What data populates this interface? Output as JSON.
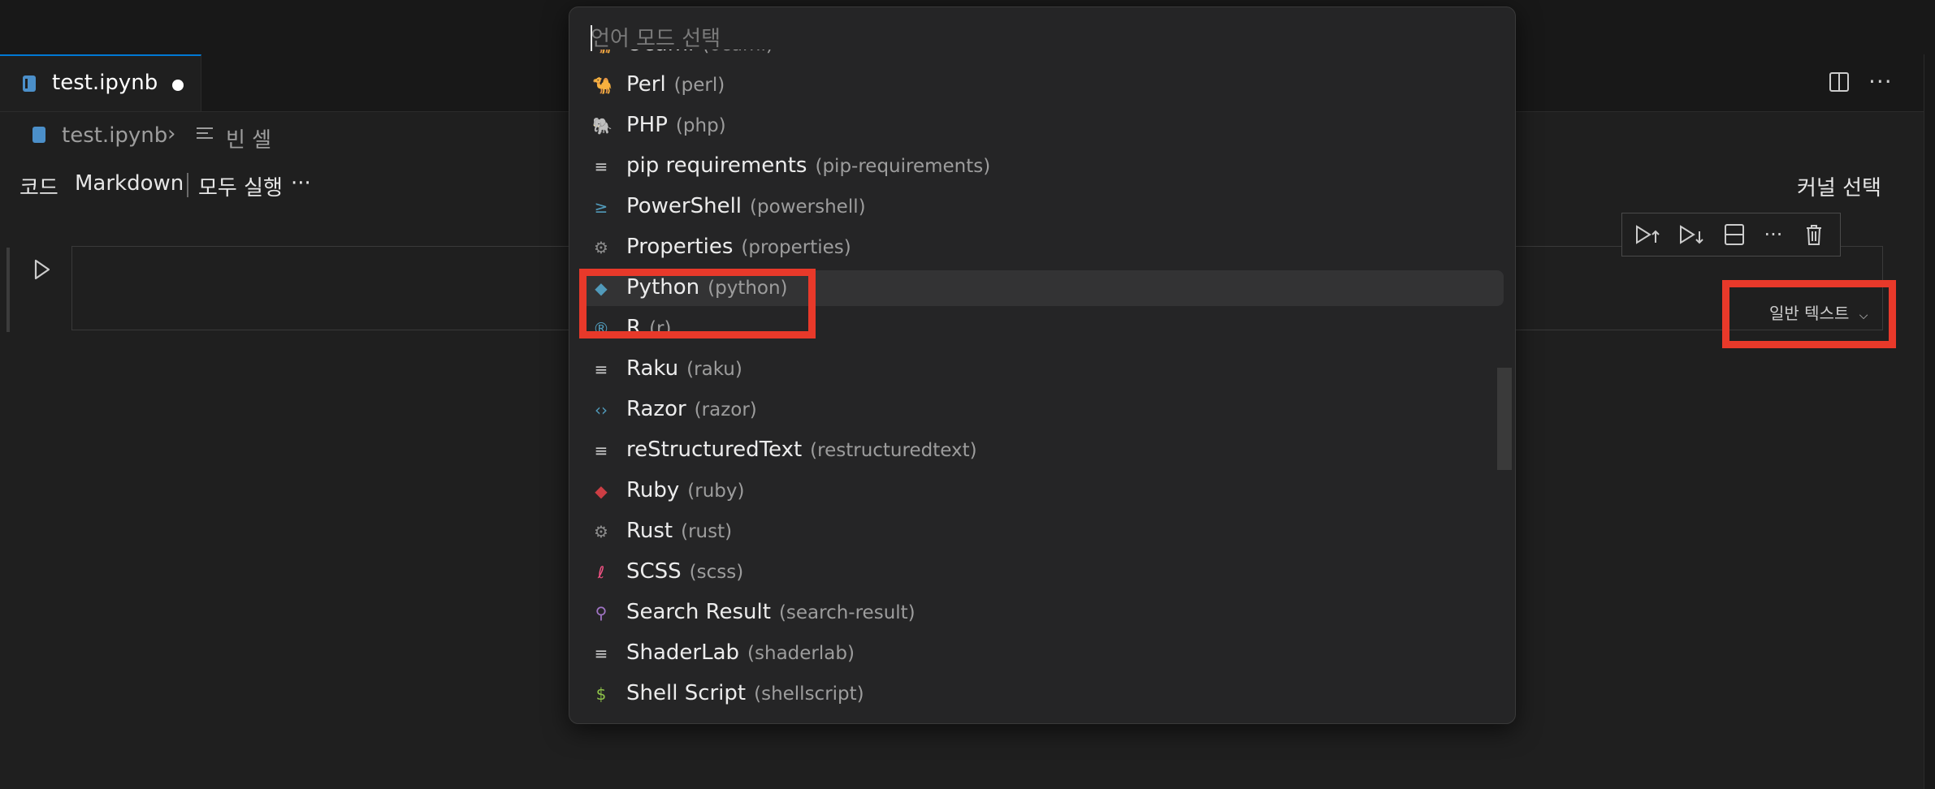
{
  "tab": {
    "label": "test.ipynb",
    "dirty": true
  },
  "breadcrumb": {
    "file": "test.ipynb",
    "separator": "›",
    "cell": "빈 셀"
  },
  "toolbar": {
    "code": "코드",
    "markdown": "Markdown",
    "run_all": "모두 실행",
    "more": "···",
    "kernel": "커널 선택"
  },
  "cell": {
    "language_button": "일반 텍스트"
  },
  "quickpick": {
    "placeholder": "언어 모드 선택",
    "items": [
      {
        "name": "Ocaml",
        "id": "(ocaml)",
        "icon": "ocaml-icon",
        "color": "#e98407"
      },
      {
        "name": "Perl",
        "id": "(perl)",
        "icon": "perl-icon",
        "color": "#519aba"
      },
      {
        "name": "PHP",
        "id": "(php)",
        "icon": "php-icon",
        "color": "#a074c4"
      },
      {
        "name": "pip requirements",
        "id": "(pip-requirements)",
        "icon": "lines-icon",
        "color": "#cccccc"
      },
      {
        "name": "PowerShell",
        "id": "(powershell)",
        "icon": "terminal-icon",
        "color": "#519aba"
      },
      {
        "name": "Properties",
        "id": "(properties)",
        "icon": "gear-icon",
        "color": "#8c8c8c"
      },
      {
        "name": "Python",
        "id": "(python)",
        "icon": "python-icon",
        "color": "#519aba",
        "active": true
      },
      {
        "name": "R",
        "id": "(r)",
        "icon": "r-icon",
        "color": "#519aba"
      },
      {
        "name": "Raku",
        "id": "(raku)",
        "icon": "lines-icon",
        "color": "#cccccc"
      },
      {
        "name": "Razor",
        "id": "(razor)",
        "icon": "code-brackets-icon",
        "color": "#519aba"
      },
      {
        "name": "reStructuredText",
        "id": "(restructuredtext)",
        "icon": "lines-icon",
        "color": "#cccccc"
      },
      {
        "name": "Ruby",
        "id": "(ruby)",
        "icon": "ruby-icon",
        "color": "#cc3e44"
      },
      {
        "name": "Rust",
        "id": "(rust)",
        "icon": "rust-icon",
        "color": "#8c8c8c"
      },
      {
        "name": "SCSS",
        "id": "(scss)",
        "icon": "scss-icon",
        "color": "#f55385"
      },
      {
        "name": "Search Result",
        "id": "(search-result)",
        "icon": "search-icon",
        "color": "#a074c4"
      },
      {
        "name": "ShaderLab",
        "id": "(shaderlab)",
        "icon": "lines-icon",
        "color": "#cccccc"
      },
      {
        "name": "Shell Script",
        "id": "(shellscript)",
        "icon": "dollar-icon",
        "color": "#8dc149"
      }
    ]
  },
  "colors": {
    "highlight": "#e8392a",
    "accent": "#0078d4"
  }
}
